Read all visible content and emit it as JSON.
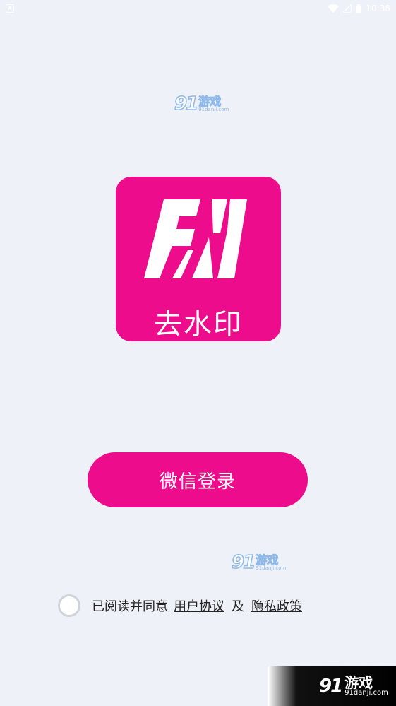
{
  "status_bar": {
    "time": "10:38",
    "notification_label": "A"
  },
  "watermark": {
    "number": "91",
    "name": "游戏",
    "url": "91danji.com"
  },
  "app_logo": {
    "mark_text": "FM",
    "name": "去水印",
    "color": "#ec0c8c"
  },
  "login": {
    "button_label": "微信登录"
  },
  "agreement": {
    "prefix": "已阅读并同意",
    "user_agreement": "用户协议",
    "and": "及",
    "privacy_policy": "隐私政策"
  },
  "corner_banner": {
    "number": "91",
    "name": "游戏",
    "url": "91danji.com"
  }
}
